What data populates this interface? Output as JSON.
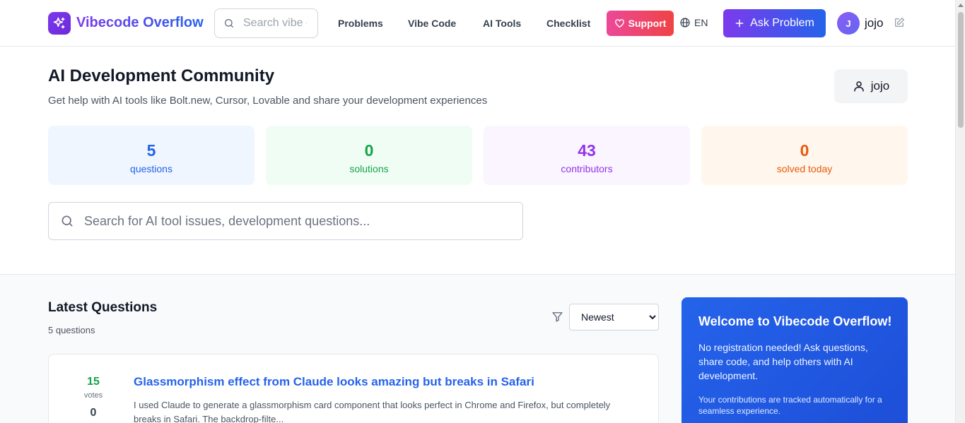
{
  "header": {
    "brand": "Vibecode Overflow",
    "search_placeholder": "Search vibe c",
    "nav": [
      "Problems",
      "Vibe Code",
      "AI Tools",
      "Checklist"
    ],
    "support_label": "Support",
    "language": "EN",
    "ask_label": "Ask Problem",
    "avatar_initial": "J",
    "username": "jojo"
  },
  "hero": {
    "title": "AI Development Community",
    "subtitle": "Get help with AI tools like Bolt.new, Cursor, Lovable and share your development experiences",
    "user_button": "jojo",
    "search_placeholder": "Search for AI tool issues, development questions..."
  },
  "stats": [
    {
      "value": "5",
      "label": "questions",
      "bg": "#eff6ff",
      "color": "#2563eb"
    },
    {
      "value": "0",
      "label": "solutions",
      "bg": "#f0fdf4",
      "color": "#16a34a"
    },
    {
      "value": "43",
      "label": "contributors",
      "bg": "#faf5ff",
      "color": "#9333ea"
    },
    {
      "value": "0",
      "label": "solved today",
      "bg": "#fff7ed",
      "color": "#ea580c"
    }
  ],
  "questions": {
    "title": "Latest Questions",
    "count": "5 questions",
    "sort_selected": "Newest",
    "items": [
      {
        "votes": "15",
        "votes_label": "votes",
        "answers": "0",
        "title": "Glassmorphism effect from Claude looks amazing but breaks in Safari",
        "excerpt": "I used Claude to generate a glassmorphism card component that looks perfect in Chrome and Firefox, but completely breaks in Safari. The backdrop-filte..."
      }
    ]
  },
  "welcome": {
    "title": "Welcome to Vibecode Overflow!",
    "body": "No registration needed! Ask questions, share code, and help others with AI development.",
    "note": "Your contributions are tracked automatically for a seamless experience."
  },
  "colors": {
    "brand_purple": "#7c3aed",
    "brand_blue": "#2563eb",
    "support_pink": "#ec4899"
  }
}
